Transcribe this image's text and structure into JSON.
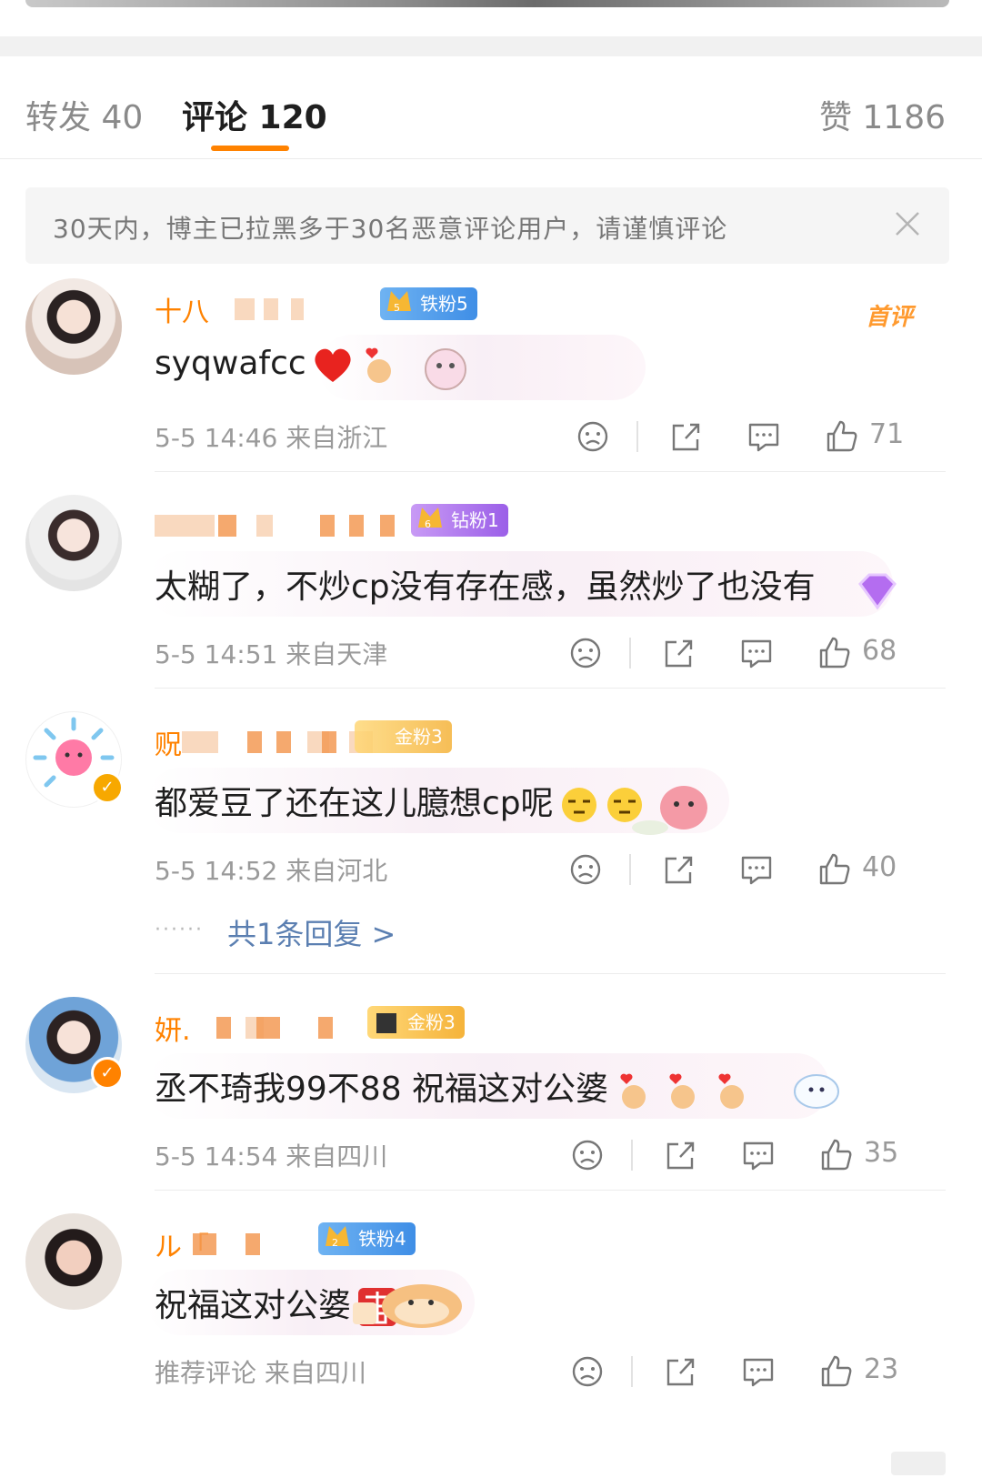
{
  "tabs": {
    "forward": "转发 40",
    "comments": "评论 120",
    "likes": "赞 1186"
  },
  "notice": {
    "text": "30天内，博主已拉黑多于30名恶意评论用户，请谨慎评论"
  },
  "comments": [
    {
      "user_visible": "十八",
      "fan_badge": "铁粉5",
      "tag": "首评",
      "text": "syqwafcc",
      "meta": "5-5 14:46 来自浙江",
      "likes": "71"
    },
    {
      "user_visible": "",
      "fan_badge": "钻粉1",
      "text": "太糊了，不炒cp没有存在感，虽然炒了也没有",
      "meta": "5-5 14:51 来自天津",
      "likes": "68"
    },
    {
      "user_visible": "贶",
      "fan_badge": "金粉3",
      "text": "都爱豆了还在这儿臆想cp呢",
      "meta": "5-5 14:52 来自河北",
      "likes": "40",
      "replies_link": "共1条回复 >"
    },
    {
      "user_visible": "妍.",
      "fan_badge": "金粉3",
      "text": "丞不琦我99不88 祝福这对公婆",
      "meta": "5-5 14:54 来自四川",
      "likes": "35"
    },
    {
      "user_visible": "ル「",
      "fan_badge": "铁粉4",
      "text": "祝福这对公婆",
      "meta": "推荐评论 来自四川",
      "likes": "23"
    }
  ]
}
